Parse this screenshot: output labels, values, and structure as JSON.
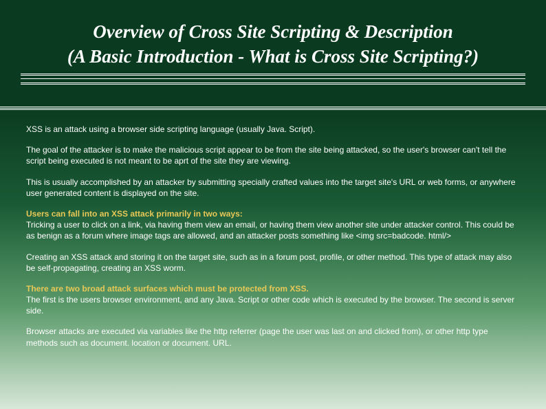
{
  "header": {
    "title_line1": "Overview of Cross Site Scripting & Description",
    "title_line2": "(A Basic Introduction - What is Cross Site Scripting?)"
  },
  "content": {
    "p1": "XSS is an attack using a browser side scripting language (usually Java. Script).",
    "p2": "The goal of the attacker is to make the malicious script appear to be from the site being attacked, so the user's browser can't tell the script being executed is not meant to be aprt of the site they are viewing.",
    "p3": "This is usually accomplished by an attacker by submitting specially crafted values into the target site's URL or web forms, or anywhere user generated content is displayed on the site.",
    "h1": "Users can fall into an XSS attack primarily in two ways:",
    "p4": "Tricking a user to click on a link, via having them view an email, or having them view another site under attacker control. This could be as benign as a forum where image tags are allowed, and an attacker posts something like <img src=badcode. html/>",
    "p5": "Creating an XSS attack and storing it on the target site, such as in a forum post, profile, or other method. This type of attack may also be self-propagating, creating an XSS worm.",
    "h2": "There are two broad attack surfaces which must be protected from XSS.",
    "p6": "The first is the users browser environment, and any Java. Script or other code which is executed by the browser. The second is server side.",
    "p7": "Browser attacks are executed via variables like the http referrer (page the user was last on and clicked from), or other http type methods such as document. location or document. URL."
  }
}
